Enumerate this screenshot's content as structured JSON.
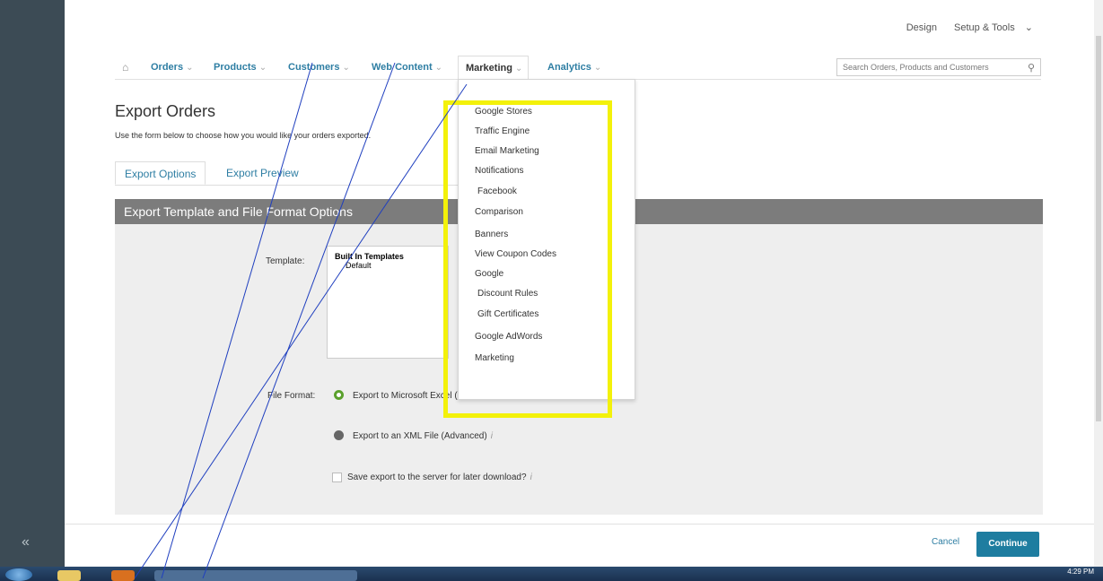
{
  "top_links": {
    "design": "Design",
    "setup_tools": "Setup & Tools"
  },
  "nav": {
    "orders": "Orders",
    "products": "Products",
    "customers": "Customers",
    "web_content": "Web Content",
    "marketing": "Marketing",
    "analytics": "Analytics",
    "search_placeholder": "Search Orders, Products and Customers"
  },
  "page": {
    "title": "Export Orders",
    "intro": "Use the form below to choose how you would like your orders exported."
  },
  "tabs": {
    "export_options": "Export Options",
    "export_preview": "Export Preview"
  },
  "panel": {
    "heading": "Export Template and File Format Options",
    "template_label": "Template:",
    "template_group": "Built In Templates",
    "template_default": "Default",
    "file_format_label": "File Format:",
    "option_excel": "Export to Microsoft Excel (CSV)",
    "option_xml": "Export to an XML File (Advanced)",
    "save_server": "Save export to the server for later download?",
    "info_icon": "i"
  },
  "marketing_menu": [
    "Google Stores",
    "Traffic Engine",
    "Email Marketing",
    "Notifications",
    "Facebook",
    "Comparison",
    "Banners",
    "View Coupon Codes",
    "Google",
    "Discount Rules",
    "Gift Certificates",
    "Google AdWords",
    "Marketing"
  ],
  "footer": {
    "cancel": "Cancel",
    "continue": "Continue"
  },
  "taskbar": {
    "clock": "4:29 PM"
  },
  "colors": {
    "accent": "#1e7da0",
    "highlight": "#f3f10a",
    "panel_header": "#7c7c7c",
    "sidebar": "#3c4b55"
  },
  "icons": {
    "home": "home-icon",
    "search": "search-icon",
    "collapse": "double-chevron-left-icon"
  }
}
